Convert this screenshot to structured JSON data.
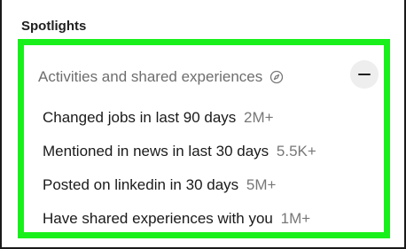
{
  "section": {
    "title": "Spotlights"
  },
  "panel": {
    "header": "Activities and shared experiences",
    "header_icon": "compass-icon",
    "collapse_icon": "minus-icon",
    "highlight_color": "#19f01b",
    "items": [
      {
        "label": "Changed jobs in last 90 days",
        "count": "2M+"
      },
      {
        "label": "Mentioned in news in last 30 days",
        "count": "5.5K+"
      },
      {
        "label": "Posted on linkedin in 30 days",
        "count": "5M+"
      },
      {
        "label": "Have shared experiences with you",
        "count": "1M+"
      }
    ]
  }
}
